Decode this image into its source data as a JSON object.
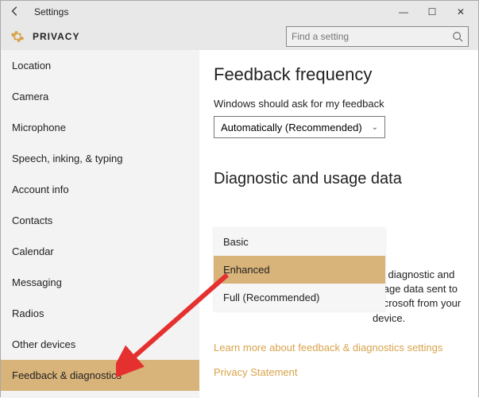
{
  "titlebar": {
    "title": "Settings"
  },
  "header": {
    "page": "PRIVACY",
    "search_placeholder": "Find a setting"
  },
  "sidebar": {
    "items": [
      {
        "label": "Location"
      },
      {
        "label": "Camera"
      },
      {
        "label": "Microphone"
      },
      {
        "label": "Speech, inking, & typing"
      },
      {
        "label": "Account info"
      },
      {
        "label": "Contacts"
      },
      {
        "label": "Calendar"
      },
      {
        "label": "Messaging"
      },
      {
        "label": "Radios"
      },
      {
        "label": "Other devices"
      },
      {
        "label": "Feedback & diagnostics"
      }
    ]
  },
  "main": {
    "feedback_heading": "Feedback frequency",
    "feedback_label": "Windows should ask for my feedback",
    "feedback_select_value": "Automatically (Recommended)",
    "diag_heading": "Diagnostic and usage data",
    "diag_options": [
      {
        "label": "Basic"
      },
      {
        "label": "Enhanced"
      },
      {
        "label": "Full (Recommended)"
      }
    ],
    "diag_desc_fragment": "ws diagnostic and usage data sent to Microsoft from your device.",
    "link_learn": "Learn more about feedback & diagnostics settings",
    "link_privacy": "Privacy Statement"
  }
}
